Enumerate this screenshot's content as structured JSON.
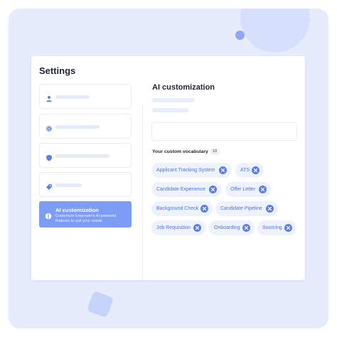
{
  "page": {
    "title": "Settings"
  },
  "sidebar": {
    "items": [
      {
        "icon": "user-icon"
      },
      {
        "icon": "gear-icon"
      },
      {
        "icon": "shield-icon"
      },
      {
        "icon": "tag-icon"
      },
      {
        "icon": "ai-icon",
        "label": "AI customization",
        "description": "Customize Empower's AI-powered features to suit your needs",
        "active": true
      }
    ]
  },
  "main": {
    "title": "AI customization",
    "vocabulary": {
      "label": "Your custom vocabulary",
      "count": "10",
      "terms": [
        "Applicant Tracking System",
        "ATS",
        "Candidate Experience",
        "Offer Letter",
        "Background Check",
        "Candidate Pipeline",
        "Job Requisition",
        "Onboarding",
        "Sourcing"
      ]
    }
  },
  "colors": {
    "accent": "#7d9cf6",
    "chip_bg": "#edf2fe",
    "chip_text": "#4c73eb",
    "frame_bg": "#e7ecfd"
  }
}
